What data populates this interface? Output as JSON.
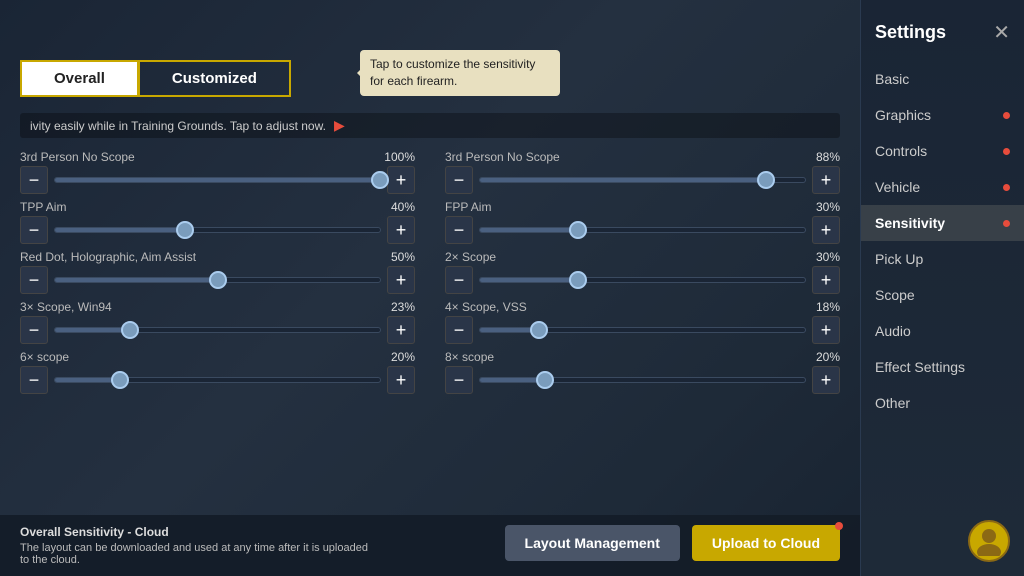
{
  "settings": {
    "title": "Settings",
    "close_label": "✕"
  },
  "tabs": {
    "overall_label": "Overall",
    "customized_label": "Customized"
  },
  "tooltip": {
    "text": "Tap to customize the sensitivity for each firearm."
  },
  "notice": {
    "text": "ivity easily while in Training Grounds. Tap to adjust now."
  },
  "sliders": [
    {
      "label": "3rd Person No Scope",
      "value": 100,
      "pct": "100%"
    },
    {
      "label": "3rd Person No Scope",
      "value": 88,
      "pct": "88%"
    },
    {
      "label": "TPP Aim",
      "value": 40,
      "pct": "40%"
    },
    {
      "label": "FPP Aim",
      "value": 30,
      "pct": "30%"
    },
    {
      "label": "Red Dot, Holographic, Aim Assist",
      "value": 50,
      "pct": "50%"
    },
    {
      "label": "2× Scope",
      "value": 30,
      "pct": "30%"
    },
    {
      "label": "3× Scope, Win94",
      "value": 23,
      "pct": "23%"
    },
    {
      "label": "4× Scope, VSS",
      "value": 18,
      "pct": "18%"
    },
    {
      "label": "6× scope",
      "value": 20,
      "pct": "20%"
    },
    {
      "label": "8× scope",
      "value": 20,
      "pct": "20%"
    }
  ],
  "bottom": {
    "info_title": "Overall Sensitivity - Cloud",
    "info_text": "The layout can be downloaded and used at any time after it is uploaded to the cloud.",
    "layout_btn": "Layout Management",
    "upload_btn": "Upload to Cloud"
  },
  "sidebar": {
    "items": [
      {
        "label": "Basic",
        "dot": false,
        "active": false
      },
      {
        "label": "Graphics",
        "dot": true,
        "active": false
      },
      {
        "label": "Controls",
        "dot": true,
        "active": false
      },
      {
        "label": "Vehicle",
        "dot": true,
        "active": false
      },
      {
        "label": "Sensitivity",
        "dot": true,
        "active": true
      },
      {
        "label": "Pick Up",
        "dot": false,
        "active": false
      },
      {
        "label": "Scope",
        "dot": false,
        "active": false
      },
      {
        "label": "Audio",
        "dot": false,
        "active": false
      },
      {
        "label": "Effect Settings",
        "dot": false,
        "active": false
      },
      {
        "label": "Other",
        "dot": false,
        "active": false
      }
    ]
  }
}
